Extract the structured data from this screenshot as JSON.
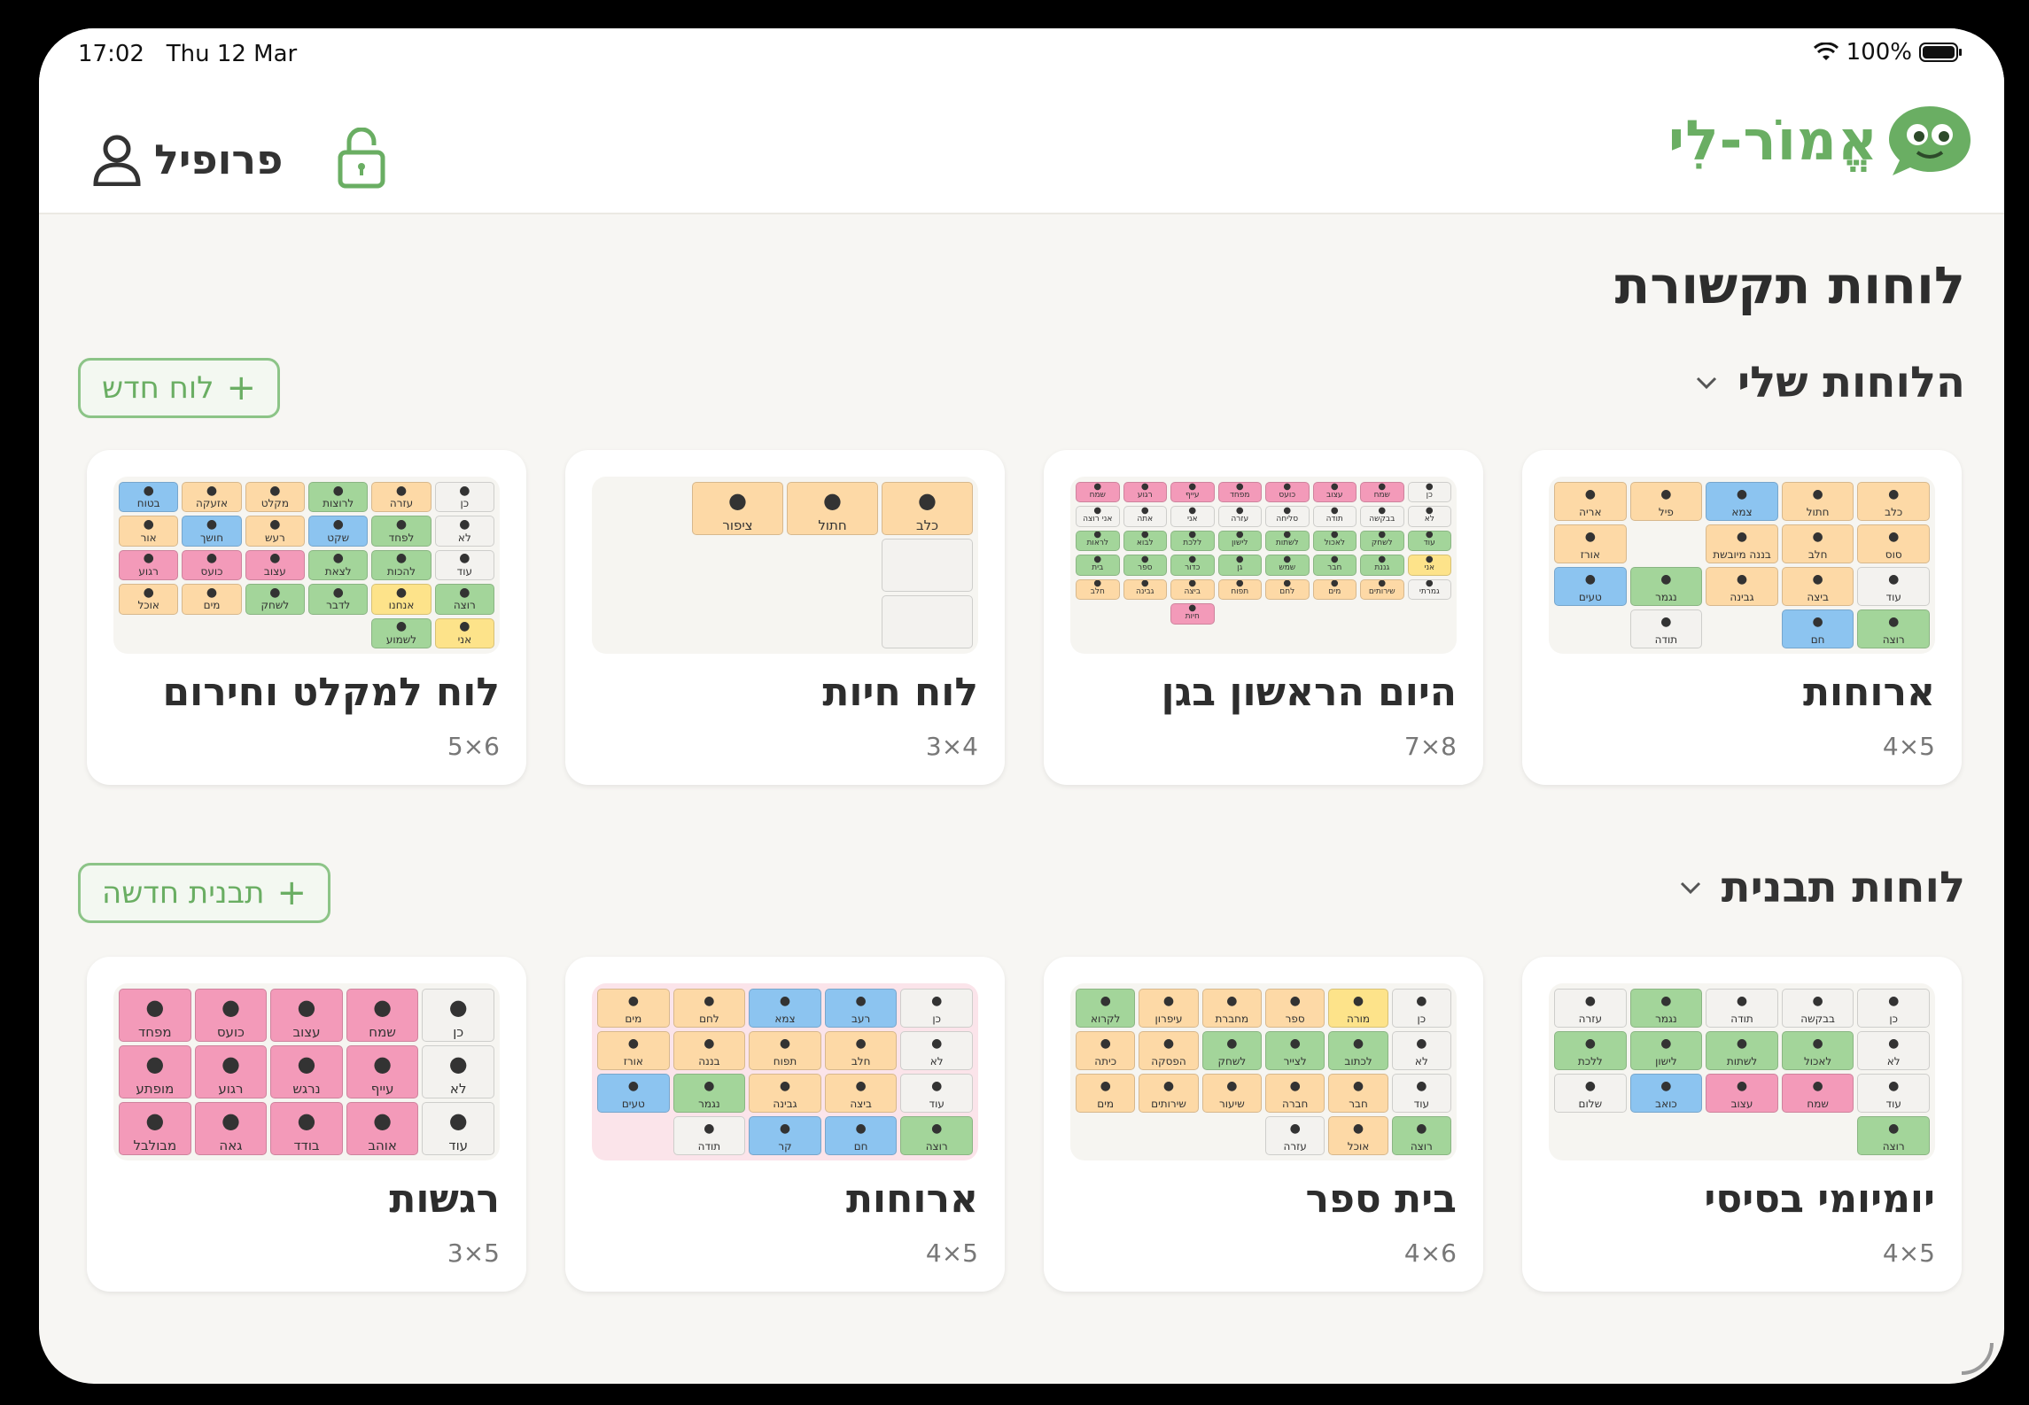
{
  "status_bar": {
    "time": "17:02",
    "date": "Thu 12 Mar",
    "battery": "100%"
  },
  "header": {
    "logo_text": "אֱמוֹר-לִי",
    "profile_label": "פרופיל"
  },
  "page_title": "לוחות תקשורת",
  "my_boards": {
    "title": "הלוחות שלי",
    "new_button": "לוח חדש",
    "cards": [
      {
        "title": "ארוחות",
        "size": "4×5"
      },
      {
        "title": "היום הראשון בגן",
        "size": "7×8"
      },
      {
        "title": "לוח חיות",
        "size": "3×4"
      },
      {
        "title": "לוח למקלט וחירום",
        "size": "5×6"
      }
    ]
  },
  "template_boards": {
    "title": "לוחות תבנית",
    "new_button": "תבנית חדשה",
    "cards": [
      {
        "title": "יומיומי בסיסי",
        "size": "4×5"
      },
      {
        "title": "בית ספר",
        "size": "4×6"
      },
      {
        "title": "ארוחות",
        "size": "4×5"
      },
      {
        "title": "רגשות",
        "size": "3×5"
      }
    ]
  },
  "thumbs": {
    "arukhot_my": {
      "cols": 5,
      "cells": [
        [
          "כלב",
          "o"
        ],
        [
          "חתול",
          "o"
        ],
        [
          "צמא",
          "b"
        ],
        [
          "פיל",
          "o"
        ],
        [
          "אריה",
          "o"
        ],
        [
          "סוס",
          "o"
        ],
        [
          "חלב",
          "o"
        ],
        [
          "בננה מיובשת",
          "o"
        ],
        [
          "",
          ""
        ],
        [
          "אורז",
          "o"
        ],
        [
          "עוד",
          "w"
        ],
        [
          "ביצה",
          "o"
        ],
        [
          "גבינה",
          "o"
        ],
        [
          "נגמר",
          "g"
        ],
        [
          "טעים",
          "b"
        ],
        [
          "רוצה",
          "g"
        ],
        [
          "חם",
          "b"
        ],
        [
          "",
          ""
        ],
        [
          "תודה",
          "w"
        ],
        [
          "",
          ""
        ]
      ]
    },
    "gan": {
      "cols": 8,
      "cells": [
        [
          "כן",
          "w"
        ],
        [
          "שמח",
          "p"
        ],
        [
          "עצוב",
          "p"
        ],
        [
          "כועס",
          "p"
        ],
        [
          "מפחד",
          "p"
        ],
        [
          "עייף",
          "p"
        ],
        [
          "רגוע",
          "p"
        ],
        [
          "שמח",
          "p"
        ],
        [
          "לא",
          "w"
        ],
        [
          "בבקשה",
          "w"
        ],
        [
          "תודה",
          "w"
        ],
        [
          "סליחה",
          "w"
        ],
        [
          "עזרה",
          "w"
        ],
        [
          "אני",
          "w"
        ],
        [
          "אתה",
          "w"
        ],
        [
          "אני רוצה",
          "w"
        ],
        [
          "עוד",
          "g"
        ],
        [
          "לשחק",
          "g"
        ],
        [
          "לאכול",
          "g"
        ],
        [
          "לשתות",
          "g"
        ],
        [
          "לישון",
          "g"
        ],
        [
          "ללכת",
          "g"
        ],
        [
          "לבוא",
          "g"
        ],
        [
          "לראות",
          "g"
        ],
        [
          "אני",
          "y"
        ],
        [
          "גננת",
          "g"
        ],
        [
          "חבר",
          "g"
        ],
        [
          "שמש",
          "g"
        ],
        [
          "גן",
          "g"
        ],
        [
          "כדור",
          "g"
        ],
        [
          "ספר",
          "g"
        ],
        [
          "בית",
          "g"
        ],
        [
          "גמרתי",
          "w"
        ],
        [
          "שירותים",
          "o"
        ],
        [
          "מים",
          "o"
        ],
        [
          "לחם",
          "o"
        ],
        [
          "תפוח",
          "o"
        ],
        [
          "ביצה",
          "o"
        ],
        [
          "גבינה",
          "o"
        ],
        [
          "חלב",
          "o"
        ],
        [
          "",
          "e"
        ],
        [
          "",
          "e"
        ],
        [
          "",
          "e"
        ],
        [
          "",
          "e"
        ],
        [
          "",
          "e"
        ],
        [
          "חיות",
          "p"
        ],
        [
          "",
          "e"
        ],
        [
          "",
          "e"
        ],
        [
          "",
          "e"
        ],
        [
          "",
          "e"
        ],
        [
          "",
          "e"
        ],
        [
          "",
          "e"
        ],
        [
          "",
          "e"
        ],
        [
          "",
          "e"
        ],
        [
          "",
          "e"
        ],
        [
          "",
          "e"
        ]
      ]
    },
    "animals": {
      "cols": 4,
      "cells": [
        [
          "כלב",
          "o"
        ],
        [
          "חתול",
          "o"
        ],
        [
          "ציפור",
          "o"
        ],
        [
          "",
          ""
        ],
        [
          "",
          "w"
        ],
        [
          "",
          ""
        ],
        [
          "",
          ""
        ],
        [
          "",
          ""
        ],
        [
          "",
          "w"
        ],
        [
          "",
          ""
        ],
        [
          "",
          ""
        ],
        [
          "",
          ""
        ]
      ]
    },
    "miklat": {
      "cols": 6,
      "cells": [
        [
          "כן",
          "w"
        ],
        [
          "עזרה",
          "o"
        ],
        [
          "לרוצות",
          "g"
        ],
        [
          "מקלט",
          "o"
        ],
        [
          "אזעקה",
          "o"
        ],
        [
          "בטוח",
          "b"
        ],
        [
          "לא",
          "w"
        ],
        [
          "לפחד",
          "g"
        ],
        [
          "שקט",
          "b"
        ],
        [
          "רעש",
          "o"
        ],
        [
          "חושך",
          "b"
        ],
        [
          "אור",
          "o"
        ],
        [
          "עוד",
          "w"
        ],
        [
          "להכות",
          "g"
        ],
        [
          "לצאת",
          "g"
        ],
        [
          "עצוב",
          "p"
        ],
        [
          "כועס",
          "p"
        ],
        [
          "רגוע",
          "p"
        ],
        [
          "רוצה",
          "g"
        ],
        [
          "אנחנו",
          "y"
        ],
        [
          "לדבר",
          "g"
        ],
        [
          "לשחק",
          "g"
        ],
        [
          "מים",
          "o"
        ],
        [
          "אוכל",
          "o"
        ],
        [
          "אני",
          "y"
        ],
        [
          "לשמוע",
          "g"
        ],
        [
          "",
          ""
        ],
        [
          "",
          ""
        ],
        [
          "",
          ""
        ],
        [
          "",
          ""
        ]
      ]
    },
    "yomyomi": {
      "cols": 5,
      "cells": [
        [
          "כן",
          "w"
        ],
        [
          "בבקשה",
          "w"
        ],
        [
          "תודה",
          "w"
        ],
        [
          "נגמר",
          "g"
        ],
        [
          "עזרה",
          "w"
        ],
        [
          "לא",
          "w"
        ],
        [
          "לאכול",
          "g"
        ],
        [
          "לשתות",
          "g"
        ],
        [
          "לישון",
          "g"
        ],
        [
          "ללכת",
          "g"
        ],
        [
          "עוד",
          "w"
        ],
        [
          "שמח",
          "p"
        ],
        [
          "עצוב",
          "p"
        ],
        [
          "כואב",
          "b"
        ],
        [
          "שלום",
          "w"
        ],
        [
          "רוצה",
          "g"
        ],
        [
          "",
          ""
        ],
        [
          "",
          ""
        ],
        [
          "",
          ""
        ],
        [
          "",
          ""
        ]
      ]
    },
    "school": {
      "cols": 6,
      "cells": [
        [
          "כן",
          "w"
        ],
        [
          "מורה",
          "y"
        ],
        [
          "ספר",
          "o"
        ],
        [
          "מחברת",
          "o"
        ],
        [
          "עיפרון",
          "o"
        ],
        [
          "לקרוא",
          "g"
        ],
        [
          "לא",
          "w"
        ],
        [
          "לכתוב",
          "g"
        ],
        [
          "לצייר",
          "g"
        ],
        [
          "לשחק",
          "g"
        ],
        [
          "הפסקה",
          "o"
        ],
        [
          "כיתה",
          "o"
        ],
        [
          "עוד",
          "w"
        ],
        [
          "חבר",
          "o"
        ],
        [
          "חברה",
          "o"
        ],
        [
          "שיעור",
          "o"
        ],
        [
          "שירותים",
          "o"
        ],
        [
          "מים",
          "o"
        ],
        [
          "רוצה",
          "g"
        ],
        [
          "אוכל",
          "o"
        ],
        [
          "עזרה",
          "w"
        ],
        [
          "",
          ""
        ],
        [
          "",
          ""
        ],
        [
          "",
          ""
        ]
      ]
    },
    "arukhot_tpl": {
      "cols": 5,
      "cells": [
        [
          "כן",
          "w"
        ],
        [
          "רעב",
          "b"
        ],
        [
          "צמא",
          "b"
        ],
        [
          "לחם",
          "o"
        ],
        [
          "מים",
          "o"
        ],
        [
          "לא",
          "w"
        ],
        [
          "חלב",
          "o"
        ],
        [
          "תפוח",
          "o"
        ],
        [
          "בננה",
          "o"
        ],
        [
          "אורז",
          "o"
        ],
        [
          "עוד",
          "w"
        ],
        [
          "ביצה",
          "o"
        ],
        [
          "גבינה",
          "o"
        ],
        [
          "נגמר",
          "g"
        ],
        [
          "טעים",
          "b"
        ],
        [
          "רוצה",
          "g"
        ],
        [
          "חם",
          "b"
        ],
        [
          "קר",
          "b"
        ],
        [
          "תודה",
          "w"
        ],
        [
          "",
          ""
        ]
      ]
    },
    "emotions": {
      "cols": 5,
      "cells": [
        [
          "כן",
          "w"
        ],
        [
          "שמח",
          "p"
        ],
        [
          "עצוב",
          "p"
        ],
        [
          "כועס",
          "p"
        ],
        [
          "מפחד",
          "p"
        ],
        [
          "לא",
          "w"
        ],
        [
          "עייף",
          "p"
        ],
        [
          "נרגש",
          "p"
        ],
        [
          "רגוע",
          "p"
        ],
        [
          "מופתע",
          "p"
        ],
        [
          "עוד",
          "w"
        ],
        [
          "אוהב",
          "p"
        ],
        [
          "בודד",
          "p"
        ],
        [
          "גאה",
          "p"
        ],
        [
          "מבולבל",
          "p"
        ]
      ]
    }
  }
}
